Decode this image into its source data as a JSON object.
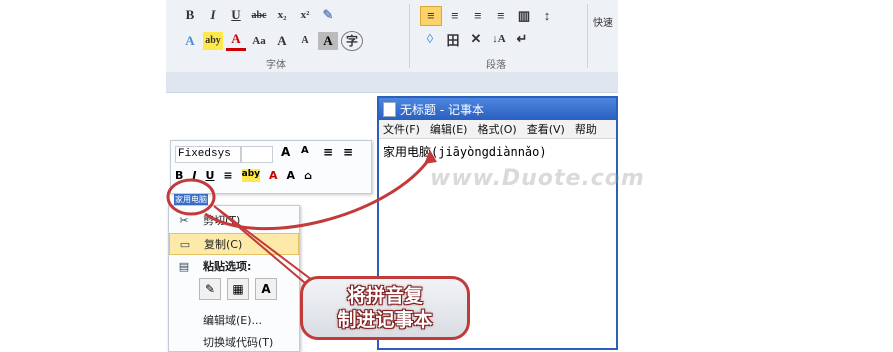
{
  "ribbon": {
    "font_buttons": [
      "B",
      "I",
      "U",
      "abc",
      "x₂",
      "x²"
    ],
    "font_row2": [
      "A",
      "aby",
      "A",
      "Aa",
      "A",
      "A",
      "A",
      "字"
    ],
    "paragraph_row1": [
      "≡",
      "≡",
      "≡",
      "≡",
      "▥",
      "↕"
    ],
    "paragraph_row2": [
      "◊",
      "田",
      "✕",
      "↓A",
      "↵"
    ],
    "font_group_label": "字体",
    "paragraph_group_label": "段落",
    "quick_label": "快速"
  },
  "mini_toolbar": {
    "font_name": "Fixedsys",
    "buttons_row1": [
      "A",
      "A",
      "≡",
      "≡"
    ],
    "buttons_row2": [
      "B",
      "I",
      "U",
      "≡",
      "aby",
      "A",
      "A",
      "⌂"
    ]
  },
  "selected_word": "家用电脑",
  "context_menu": {
    "items": [
      {
        "icon": "cut-icon",
        "glyph": "✂",
        "label": "剪切(T)"
      },
      {
        "icon": "copy-icon",
        "glyph": "▭",
        "label": "复制(C)"
      },
      {
        "icon": "paste-icon",
        "glyph": "▤",
        "label": "粘贴选项:"
      },
      {
        "icon": "none",
        "glyph": "",
        "label": "编辑域(E)..."
      },
      {
        "icon": "none",
        "glyph": "",
        "label": "切换域代码(T)"
      }
    ],
    "paste_option_icons": [
      "✎",
      "▦",
      "A"
    ]
  },
  "notepad": {
    "title": "无标题 - 记事本",
    "menu": [
      "文件(F)",
      "编辑(E)",
      "格式(O)",
      "查看(V)",
      "帮助"
    ],
    "content": "家用电脑(jiāyòngdiànnǎo)"
  },
  "callout": {
    "line1": "将拼音复",
    "line2": "制进记事本"
  },
  "watermark": "www.Duote.com",
  "colors": {
    "annotation_red": "#c23a3a",
    "notepad_title_blue": "#2a5fbf",
    "menu_highlight": "#fde9a8"
  }
}
